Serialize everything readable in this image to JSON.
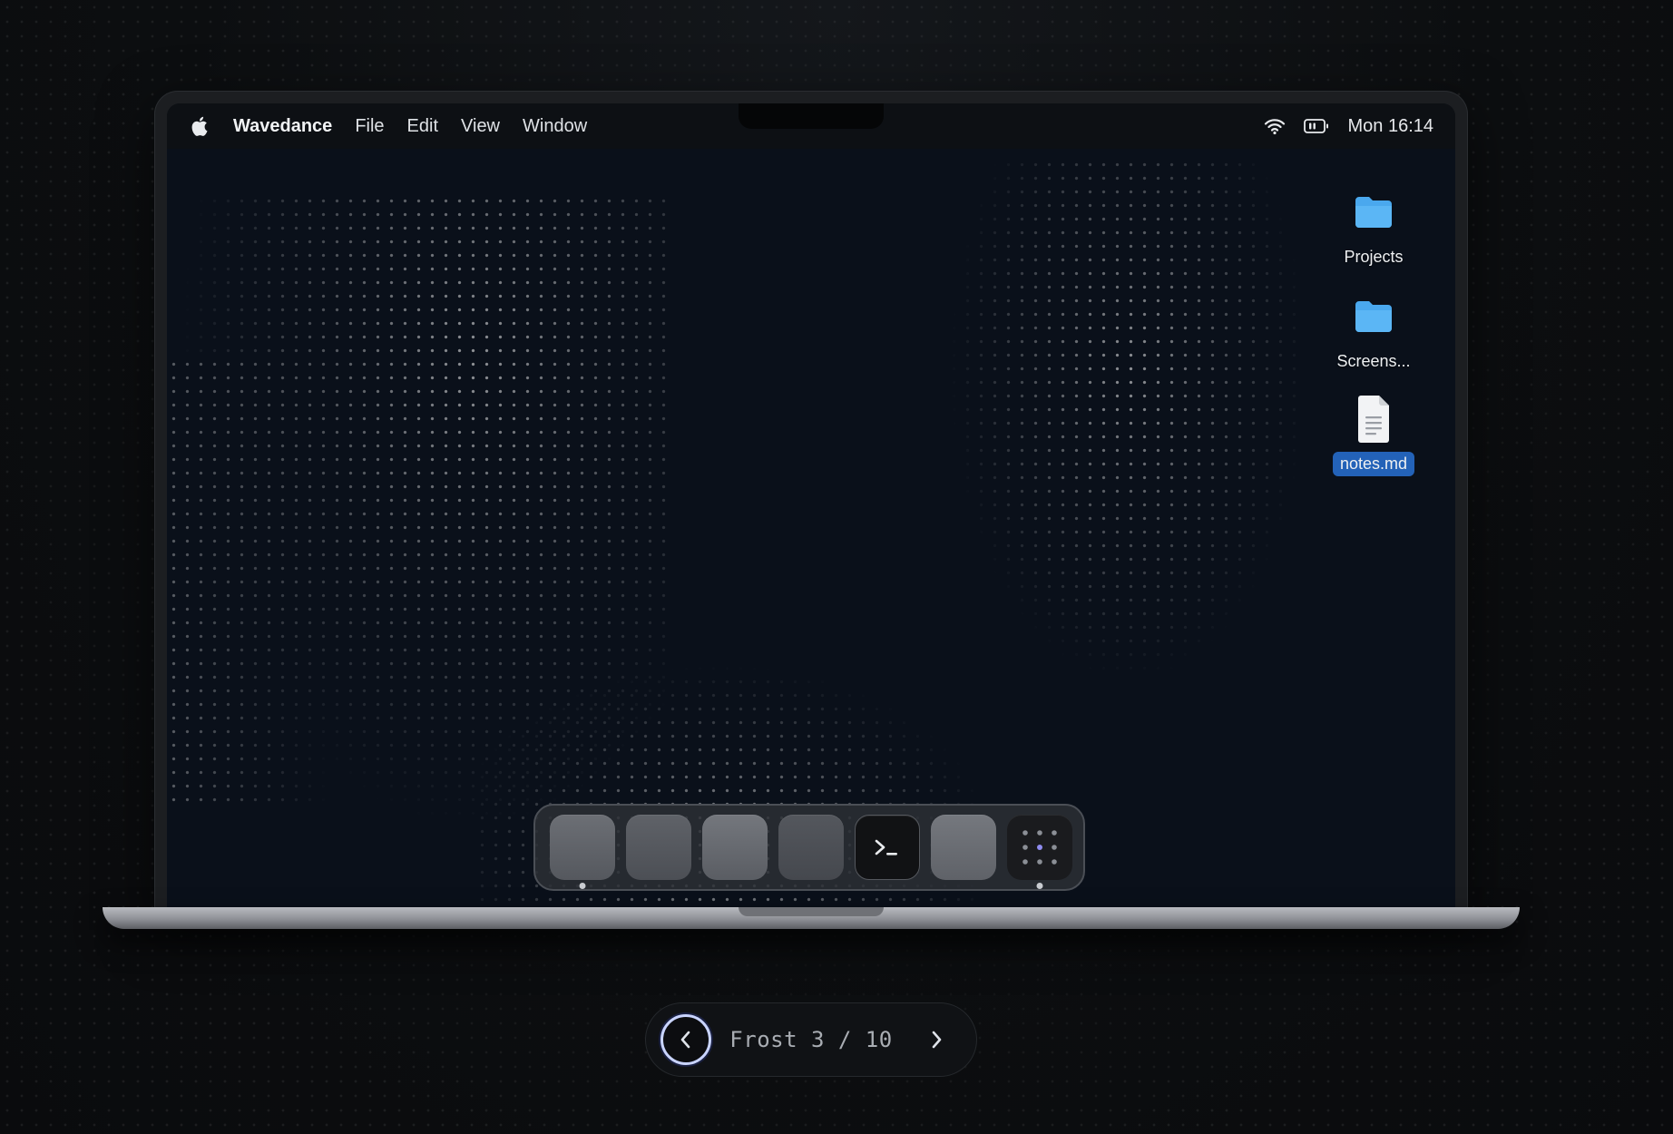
{
  "menubar": {
    "app_name": "Wavedance",
    "menus": [
      "File",
      "Edit",
      "View",
      "Window"
    ],
    "clock": "Mon 16:14",
    "status_icons": [
      "wifi-icon",
      "battery-icon"
    ]
  },
  "desktop": {
    "items": [
      {
        "label": "Projects",
        "icon": "folder-icon",
        "selected": false
      },
      {
        "label": "Screens...",
        "icon": "folder-icon",
        "selected": false
      },
      {
        "label": "notes.md",
        "icon": "document-icon",
        "selected": true
      }
    ]
  },
  "dock": {
    "items": [
      {
        "icon": "app-tile",
        "running": true
      },
      {
        "icon": "app-tile",
        "running": false
      },
      {
        "icon": "app-tile",
        "running": false
      },
      {
        "icon": "app-tile",
        "running": false
      },
      {
        "icon": "terminal-icon",
        "running": false
      },
      {
        "icon": "app-tile",
        "running": false
      },
      {
        "icon": "launchpad-icon",
        "running": true
      }
    ]
  },
  "pager": {
    "label": "Frost 3 / 10"
  },
  "colors": {
    "folder": "#4aa8ee",
    "selection": "#2362b8",
    "screen_bg": "#0a101a"
  }
}
